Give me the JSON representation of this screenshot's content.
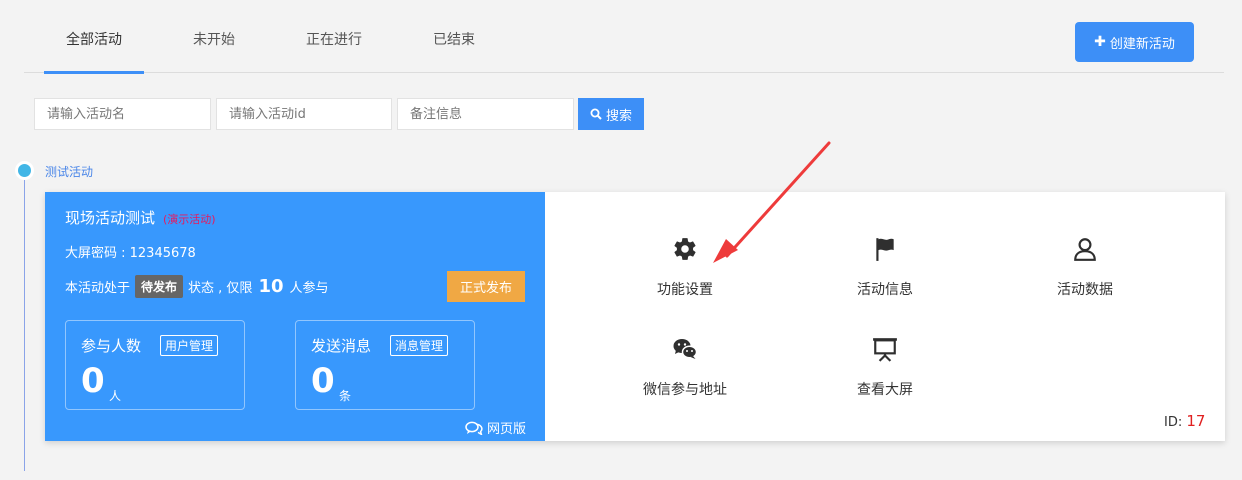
{
  "tabs": [
    {
      "label": "全部活动",
      "active": true
    },
    {
      "label": "未开始",
      "active": false
    },
    {
      "label": "正在进行",
      "active": false
    },
    {
      "label": "已结束",
      "active": false
    }
  ],
  "create_button": {
    "label": "创建新活动",
    "icon": "plus-icon"
  },
  "search": {
    "name_placeholder": "请输入活动名",
    "id_placeholder": "请输入活动id",
    "note_placeholder": "备注信息",
    "button_label": "搜索"
  },
  "group": {
    "label": "测试活动"
  },
  "activity": {
    "name": "现场活动测试",
    "demo_tag": "(演示活动)",
    "screen_password": "大屏密码 : 12345678",
    "status_prefix": "本活动处于",
    "status_badge": "待发布",
    "status_mid": "状态 , 仅限",
    "limit": "10",
    "status_suffix": "人参与",
    "publish_button": "正式发布",
    "participants": {
      "title": "参与人数",
      "manage": "用户管理",
      "value": "0",
      "unit": "人"
    },
    "messages": {
      "title": "发送消息",
      "manage": "消息管理",
      "value": "0",
      "unit": "条"
    },
    "web_version": "网页版",
    "id_label": "ID:",
    "id_value": "17"
  },
  "functions": [
    {
      "label": "功能设置",
      "icon": "gear-icon"
    },
    {
      "label": "活动信息",
      "icon": "flag-icon"
    },
    {
      "label": "活动数据",
      "icon": "user-icon"
    },
    {
      "label": "微信参与地址",
      "icon": "wechat-icon"
    },
    {
      "label": "查看大屏",
      "icon": "presentation-icon"
    }
  ],
  "colors": {
    "accent": "#3d8ff7",
    "card_blue": "#3898fd",
    "publish_orange": "#f0a844",
    "arrow_red": "#ee3b3b"
  }
}
